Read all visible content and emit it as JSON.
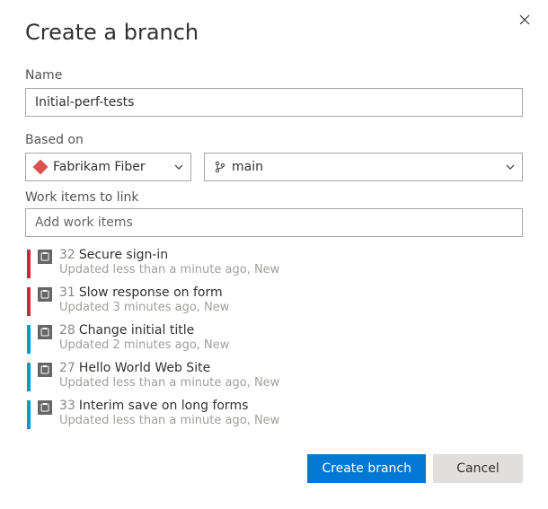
{
  "dialog": {
    "title": "Create a branch",
    "name_label": "Name",
    "name_value": "Initial-perf-tests",
    "based_on_label": "Based on",
    "repo": "Fabrikam Fiber",
    "branch": "main",
    "work_items_label": "Work items to link",
    "work_items_placeholder": "Add work items",
    "create_label": "Create branch",
    "cancel_label": "Cancel"
  },
  "work_items": [
    {
      "id": "32",
      "title": "Secure sign-in",
      "meta": "Updated less than a minute ago, New",
      "color": "red"
    },
    {
      "id": "31",
      "title": "Slow response on form",
      "meta": "Updated 3 minutes ago, New",
      "color": "red"
    },
    {
      "id": "28",
      "title": "Change initial title",
      "meta": "Updated 2 minutes ago, New",
      "color": "blue"
    },
    {
      "id": "27",
      "title": "Hello World Web Site",
      "meta": "Updated less than a minute ago, New",
      "color": "blue"
    },
    {
      "id": "33",
      "title": "Interim save on long forms",
      "meta": "Updated less than a minute ago, New",
      "color": "blue"
    }
  ]
}
